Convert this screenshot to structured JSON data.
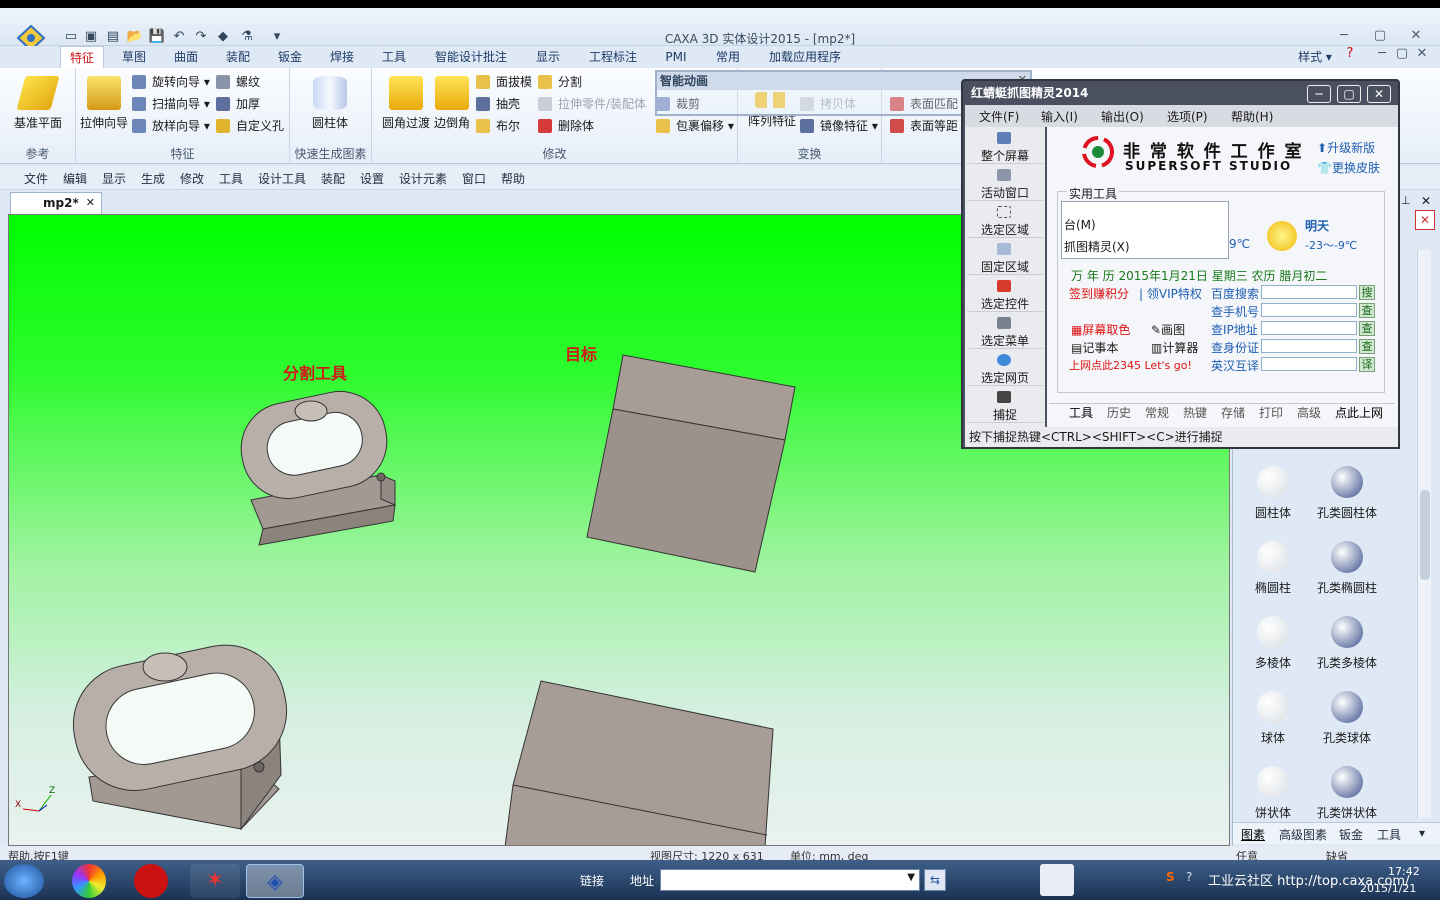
{
  "window": {
    "title": "CAXA 3D 实体设计2015 - [mp2*]"
  },
  "ribbon": {
    "tabs": [
      "特征",
      "草图",
      "曲面",
      "装配",
      "钣金",
      "焊接",
      "工具",
      "智能设计批注",
      "显示",
      "工程标注",
      "PMI",
      "常用",
      "加载应用程序"
    ],
    "active_tab": "特征",
    "right_label": "样式",
    "groups": {
      "reference": {
        "caption": "参考",
        "btn": "基准平面"
      },
      "feature": {
        "caption": "特征",
        "big": "拉伸向导",
        "items": [
          "旋转向导",
          "扫描向导",
          "放样向导",
          "螺纹",
          "加厚",
          "自定义孔"
        ]
      },
      "quick": {
        "caption": "快速生成图素",
        "btn": "圆柱体"
      },
      "modify": {
        "caption": "修改",
        "big1": "圆角过渡",
        "big2": "边倒角",
        "items": [
          "面拔模",
          "抽壳",
          "布尔",
          "分割",
          "拉伸零件/装配体",
          "删除体",
          "裁剪",
          "包裹偏移"
        ]
      },
      "transform": {
        "caption": "变换",
        "items": [
          "阵列特征",
          "拷贝体",
          "镜像特征"
        ]
      },
      "surface": {
        "items": [
          "表面匹配",
          "表面等距"
        ]
      }
    }
  },
  "menubar": {
    "items": [
      "文件",
      "编辑",
      "显示",
      "生成",
      "修改",
      "工具",
      "设计工具",
      "装配",
      "设置",
      "设计元素",
      "窗口",
      "帮助"
    ]
  },
  "document": {
    "tab": "mp2*"
  },
  "viewport": {
    "labels": {
      "split_tool": "分割工具",
      "target": "目标"
    },
    "axis_labels": [
      "Z",
      "X"
    ]
  },
  "smart_anim": {
    "title": "智能动画"
  },
  "right_panel": {
    "items": [
      {
        "label": "圆柱体",
        "color": "#d8dde2"
      },
      {
        "label": "孔类圆柱体",
        "color": "#3a4f8a"
      },
      {
        "label": "椭圆柱",
        "color": "#d8dde2"
      },
      {
        "label": "孔类椭圆柱",
        "color": "#3a4f8a"
      },
      {
        "label": "多棱体",
        "color": "#d8dde2"
      },
      {
        "label": "孔类多棱体",
        "color": "#3a4f8a"
      },
      {
        "label": "球体",
        "color": "#d8dde2"
      },
      {
        "label": "孔类球体",
        "color": "#3a4f8a"
      },
      {
        "label": "饼状体",
        "color": "#d8dde2"
      },
      {
        "label": "孔类饼状体",
        "color": "#3a4f8a"
      }
    ],
    "tabs": [
      "图素",
      "高级图素",
      "钣金",
      "工具"
    ]
  },
  "capture_tool": {
    "title": "红蜻蜓抓图精灵2014",
    "menus": [
      "文件(F)",
      "输入(I)",
      "输出(O)",
      "选项(P)",
      "帮助(H)"
    ],
    "left_buttons": [
      "整个屏幕",
      "活动窗口",
      "选定区域",
      "固定区域",
      "选定控件",
      "选定菜单",
      "选定网页",
      "捕捉"
    ],
    "brand_cn": "非 常 软 件 工 作 室",
    "brand_en": "SUPERSOFT STUDIO",
    "upgrade": "升级新版",
    "skin": "更换皮肤",
    "tools_title": "实用工具",
    "tool_menu": [
      "台(M)",
      "抓图精灵(X)"
    ],
    "weather_day": "明天",
    "weather_temp": "-23～-9℃",
    "weather_partial": "9℃",
    "calendar": "万 年 历 2015年1月21日 星期三 农历 腊月初二",
    "signin": "签到赚积分",
    "vip": "领VIP特权",
    "apps": [
      "屏幕取色",
      "画图",
      "记事本",
      "计算器"
    ],
    "promo": "上网点此2345 Let's go!",
    "queries": [
      {
        "label": "百度搜索",
        "btn": "搜"
      },
      {
        "label": "查手机号",
        "btn": "查"
      },
      {
        "label": "查IP地址",
        "btn": "查"
      },
      {
        "label": "查身份证",
        "btn": "查"
      },
      {
        "label": "英汉互译",
        "btn": "译"
      }
    ],
    "bottom_tabs": [
      "工具",
      "历史",
      "常规",
      "热键",
      "存储",
      "打印",
      "高级",
      "点此上网"
    ],
    "status": "按下捕捉热键<CTRL><SHIFT><C>进行捕捉"
  },
  "statusbar": {
    "help": "帮助,按F1键",
    "view_size": "视图尺寸: 1220 x 631",
    "units": "单位: mm, deg",
    "any": "任意",
    "mode": "缺省"
  },
  "taskbar": {
    "link": "链接",
    "address": "地址",
    "tray_text": "工业云社区 http://top.caxa.com/",
    "time": "17:42",
    "date": "2015/1/21"
  }
}
